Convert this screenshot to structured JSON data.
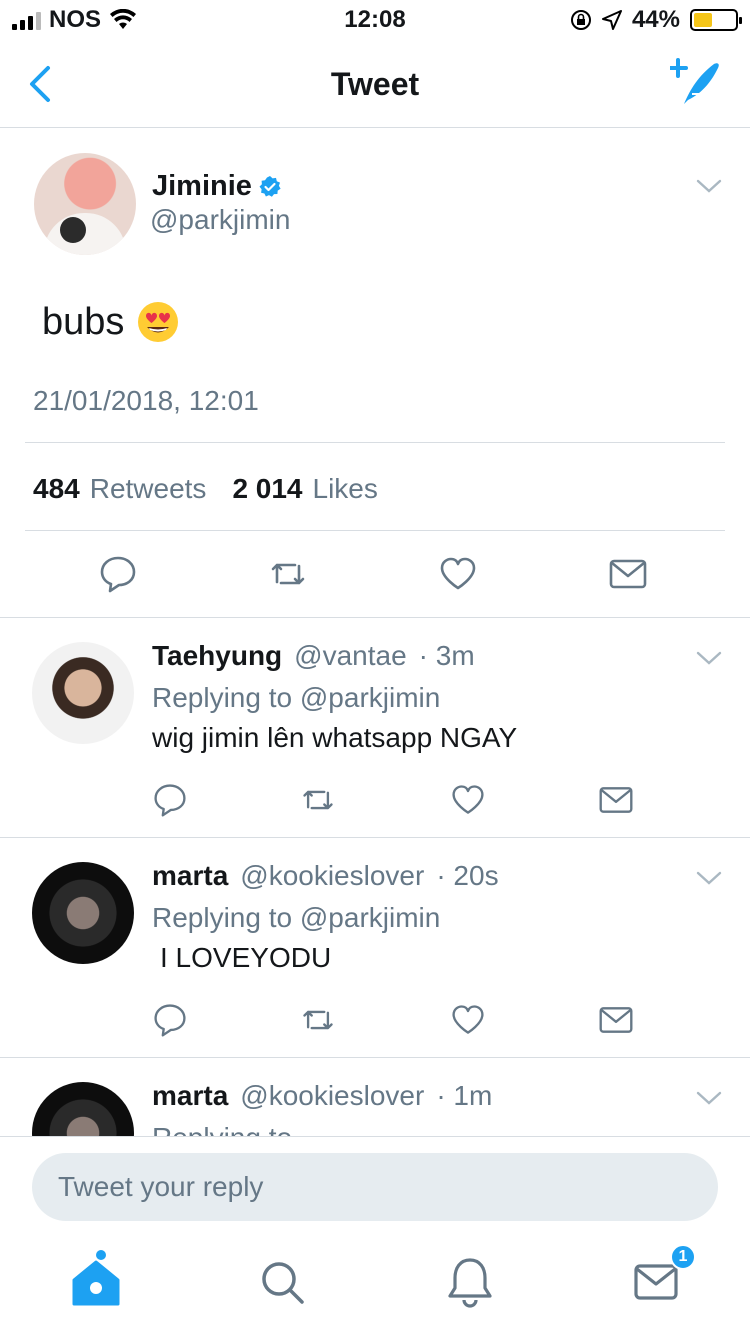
{
  "status_bar": {
    "carrier": "NOS",
    "time": "12:08",
    "battery": "44%",
    "battery_level": 0.44,
    "icons": [
      "signal-icon",
      "wifi-icon",
      "rotation-lock-icon",
      "location-icon",
      "battery-icon"
    ]
  },
  "nav": {
    "title": "Tweet",
    "icons": [
      "back-chevron-icon",
      "compose-tweet-icon"
    ]
  },
  "main_tweet": {
    "display_name": "Jiminie",
    "handle": "@parkjimin",
    "verified": true,
    "text": "bubs",
    "emoji": "heart-eyes-emoji",
    "timestamp": "21/01/2018, 12:01",
    "retweets_count": "484",
    "retweets_label": "Retweets",
    "likes_count": "2 014",
    "likes_label": "Likes"
  },
  "replies": [
    {
      "name": "Taehyung",
      "handle": "@vantae",
      "time": "· 3m",
      "replying_prefix": "Replying to",
      "replying_to": "@parkjimin",
      "text": "wig jimin lên whatsapp NGAY"
    },
    {
      "name": "marta",
      "handle": "@kookieslover",
      "time": "· 20s",
      "replying_prefix": "Replying to",
      "replying_to": "@parkjimin",
      "text": "I LOVEYODU"
    },
    {
      "name": "marta",
      "handle": "@kookieslover",
      "time": "· 1m",
      "replying_prefix": "Replying to",
      "replying_to": ""
    }
  ],
  "reply_box": {
    "placeholder": "Tweet your reply"
  },
  "tab_bar": {
    "items": [
      "home-icon",
      "search-icon",
      "notifications-icon",
      "messages-icon"
    ],
    "messages_badge": "1"
  },
  "colors": {
    "accent": "#1da1f2",
    "muted_text": "#657786",
    "divider": "#d8dde2",
    "input_bg": "#e6ecf0"
  }
}
